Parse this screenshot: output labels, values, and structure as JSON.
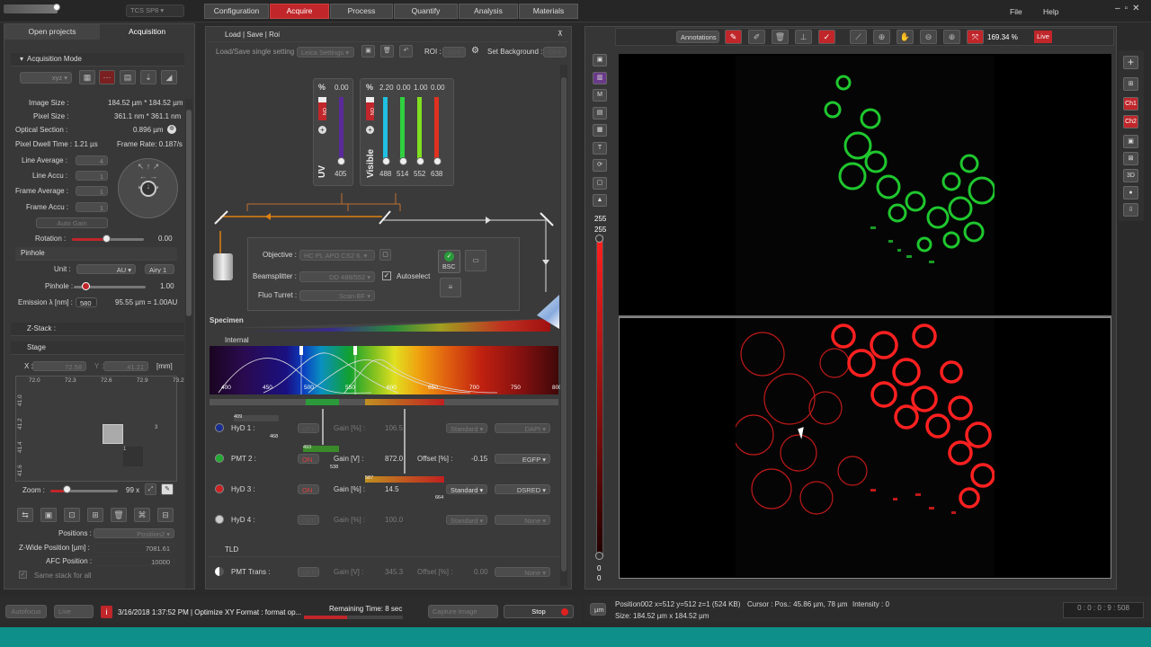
{
  "titlebar": {
    "logo_text": "",
    "system": "TCS SP8"
  },
  "workflow_tabs": [
    "Configuration",
    "Acquire",
    "Process",
    "Quantify",
    "Analysis",
    "Materials"
  ],
  "menu": {
    "file": "File",
    "help": "Help"
  },
  "left": {
    "tabs": [
      "Open projects",
      "Acquisition"
    ],
    "acq_mode": {
      "title": "Acquisition Mode",
      "mode": "xyz"
    },
    "image_size": {
      "label": "Image Size :",
      "value": "184.52 µm * 184.52 µm"
    },
    "pixel_size": {
      "label": "Pixel Size :",
      "value": "361.1 nm * 361.1 nm"
    },
    "optical_section": {
      "label": "Optical Section :",
      "value": "0.896 µm"
    },
    "dwell": {
      "label": "Pixel Dwell Time : 1.21 µs",
      "frame_rate": "Frame Rate: 0.187/s"
    },
    "line_average": {
      "label": "Line Average :",
      "value": "4"
    },
    "line_accu": {
      "label": "Line Accu :",
      "value": "1"
    },
    "frame_average": {
      "label": "Frame Average :",
      "value": "1"
    },
    "frame_accu": {
      "label": "Frame Accu :",
      "value": "1"
    },
    "auto_gain": "Auto Gain",
    "rotation": {
      "label": "Rotation :",
      "value": "0.00"
    },
    "pinhole_section": "Pinhole",
    "unit": {
      "label": "Unit :",
      "value": "AU",
      "airy": "Airy 1"
    },
    "pinhole": {
      "label": "Pinhole :",
      "value": "1.00"
    },
    "emission": {
      "label": "Emission λ [nm] :",
      "value": "580",
      "result": "95.55 µm = 1.00AU"
    },
    "zstack": "Z-Stack :",
    "stage": "Stage",
    "stage_x": {
      "label": "X :",
      "value": "72.58"
    },
    "stage_y": {
      "label": "Y :",
      "value": "41.21"
    },
    "stage_unit": "[mm]",
    "ruler_x": [
      "72.0",
      "72.3",
      "72.6",
      "72.9",
      "73.2"
    ],
    "ruler_y": [
      "41.0",
      "41.2",
      "41.4",
      "41.6"
    ],
    "tiles": [
      "3",
      "1"
    ],
    "zoom": {
      "label": "Zoom :",
      "value": "99 x"
    },
    "positions": {
      "label": "Positions :",
      "value": "Position2"
    },
    "zwide": {
      "label": "Z-Wide Position [µm] :",
      "value": "7081.61"
    },
    "afc": {
      "label": "AFC Position :",
      "value": "10000"
    },
    "same_stack": "Same stack for all"
  },
  "center": {
    "section_title": "Load | Save | Roi",
    "load_save": "Load/Save single setting :",
    "leica_settings": "Leica Settings",
    "roi": "ROI :",
    "roi_toggle": "OFF",
    "set_bg": "Set Background :",
    "bg_toggle": "OFF",
    "uv": {
      "label": "UV",
      "percent": "%",
      "value": "0.00",
      "wavelengths": [
        "405"
      ],
      "state": "ON"
    },
    "visible": {
      "label": "Visible",
      "percent": "%",
      "values": [
        "2.20",
        "0.00",
        "1.00",
        "0.00"
      ],
      "wavelengths": [
        "488",
        "514",
        "552",
        "638"
      ],
      "state": "ON"
    },
    "objective": {
      "label": "Objective :",
      "value": "HC PL APO CS2   6."
    },
    "beamsplitter": {
      "label": "Beamsplitter :",
      "value": "DD 488/552",
      "autoselect": "Autoselect"
    },
    "fluo": {
      "label": "Fluo Turret :",
      "value": "Scan-BF"
    },
    "bsc": "BSC",
    "specimen": "Specimen",
    "internal": "Internal",
    "spectrum_ticks": [
      "400",
      "450",
      "500",
      "550",
      "600",
      "650",
      "700",
      "750",
      "800"
    ],
    "detectors": [
      {
        "name": "HyD 1 :",
        "state": "OFF",
        "gain_label": "Gain [%] :",
        "gain": "106.5",
        "mode": "Standard",
        "dye": "DAPI",
        "range": [
          "409",
          "468"
        ],
        "color": "#1a2f8f"
      },
      {
        "name": "PMT 2 :",
        "state": "ON",
        "gain_label": "Gain [V] :",
        "gain": "872.0",
        "offset_label": "Offset [%] :",
        "offset": "-0.15",
        "dye": "EGFP",
        "range": [
          "493",
          "538"
        ],
        "color": "#22aa33"
      },
      {
        "name": "HyD 3 :",
        "state": "ON",
        "gain_label": "Gain [%] :",
        "gain": "14.5",
        "mode": "Standard",
        "dye": "DSRED",
        "range": [
          "587",
          "664"
        ],
        "color": "#cc2222"
      },
      {
        "name": "HyD 4 :",
        "state": "OFF",
        "gain_label": "Gain [%] :",
        "gain": "100.0",
        "mode": "Standard",
        "dye": "None",
        "color": "#cccccc"
      }
    ],
    "tld": "TLD",
    "pmt_trans": {
      "name": "PMT Trans :",
      "state": "OFF",
      "gain_label": "Gain [V] :",
      "gain": "345.3",
      "offset_label": "Offset [%] :",
      "offset": "0.00",
      "dye": "None"
    }
  },
  "viewer": {
    "annotations": "Annotations",
    "zoom": "169.34 %",
    "live": "Live",
    "lut_top": "255",
    "lut_top2": "255",
    "lut_bottom": "0",
    "lut_bottom2": "0",
    "channels": [
      "Ch1",
      "Ch2",
      "3D"
    ],
    "status_line1": "Position002 x=512 y=512 z=1 (524 KB)",
    "cursor": "Cursor :  Pos.: 45.86 µm, 78 µm",
    "intensity": "Intensity : 0",
    "status_line2": "Size: 184.52 µm x 184.52 µm",
    "unit_btn": "µm",
    "timer": "0 : 0 : 0 : 9 : 508"
  },
  "bottom": {
    "autofocus": "Autofocus",
    "live": "Live",
    "message": "3/16/2018 1:37:52 PM | Optimize XY Format : format op...",
    "remaining": "Remaining Time: 8 sec",
    "capture": "Capture Image",
    "stop": "Stop"
  },
  "colors": {
    "accent_red": "#c0262a",
    "teal": "#0e8f89",
    "green_channel": "#22dd33",
    "red_channel": "#ff2020"
  }
}
